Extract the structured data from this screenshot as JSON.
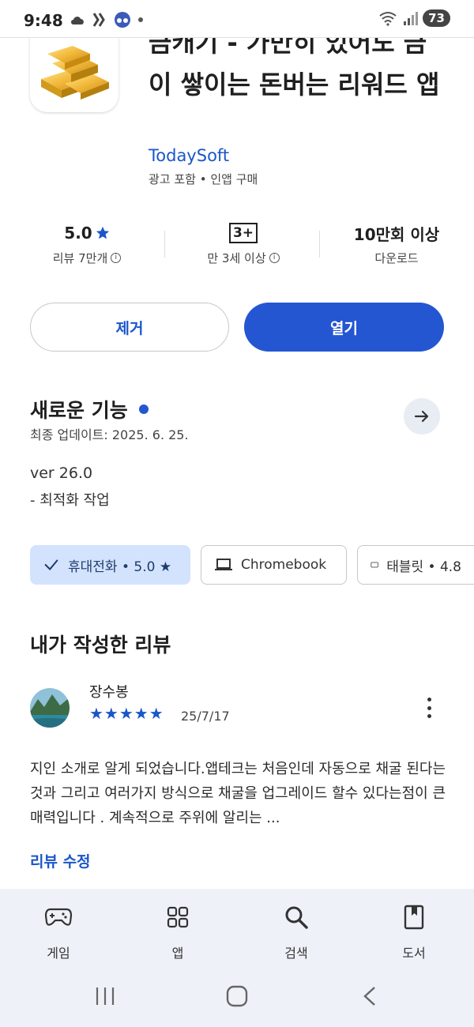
{
  "status_bar": {
    "time": "9:48",
    "battery": "73"
  },
  "app": {
    "title": "금캐기 - 가만히 있어도 금이 쌓이는 돈버는 리워드 앱",
    "developer": "TodaySoft",
    "meta": "광고 포함 • 인앱 구매"
  },
  "stats": {
    "rating_value": "5.0",
    "rating_label": "리뷰 7만개",
    "age_badge": "3+",
    "age_label": "만 3세 이상",
    "downloads_value": "10만회 이상",
    "downloads_label": "다운로드"
  },
  "actions": {
    "remove_label": "제거",
    "open_label": "열기"
  },
  "whats_new": {
    "title": "새로운 기능",
    "updated": "최종 업데이트: 2025. 6. 25.",
    "version": "ver 26.0",
    "note": "- 최적화 작업"
  },
  "devices": {
    "phone": "휴대전화 • 5.0 ★",
    "chromebook": "Chromebook",
    "tablet": "태블릿 • 4.8"
  },
  "my_review": {
    "title": "내가 작성한 리뷰",
    "reviewer": "장수봉",
    "stars": "★★★★★",
    "rating": 5,
    "date": "25/7/17",
    "text": "지인 소개로 알게 되었습니다.앱테크는 처음인데 자동으로 채굴 된다는것과 그리고 여러가지 방식으로 채굴을 업그레이드 할수 있다는점이 큰 매력입니다 . 계속적으로 주위에 알리는 ...",
    "edit_label": "리뷰 수정"
  },
  "bottom_nav": {
    "games": "게임",
    "apps": "앱",
    "search": "검색",
    "books": "도서"
  },
  "colors": {
    "accent": "#2456d1",
    "link": "#1a56c9",
    "chip_selected": "#d3e3fd",
    "nav_bg": "#eef2f8"
  }
}
